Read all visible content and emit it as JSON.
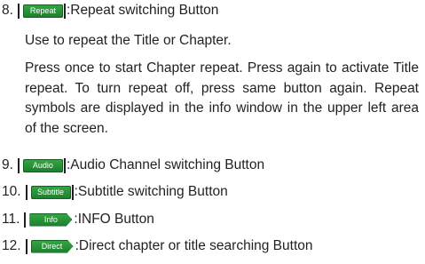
{
  "items": [
    {
      "number": "8.",
      "button": "Repeat",
      "desc": ":Repeat switching Button"
    },
    {
      "number": "9.",
      "button": "Audio",
      "desc": ":Audio Channel switching Button"
    },
    {
      "number": "10.",
      "button": "Subtitle",
      "desc": ":Subtitle switching Button"
    },
    {
      "number": "11.",
      "button": "Info",
      "desc": ":INFO Button"
    },
    {
      "number": "12.",
      "button": "Direct",
      "desc": ":Direct chapter or title searching Button"
    }
  ],
  "repeat_usage": "Use to repeat the Title or Chapter.",
  "repeat_detail": "Press once to start Chapter repeat. Press again to activate Title repeat. To turn repeat off, press same button again. Repeat symbols are displayed in the info window in the upper left area of the screen.",
  "colors": {
    "button_green": "#2a9a3a",
    "text": "#231f20"
  }
}
